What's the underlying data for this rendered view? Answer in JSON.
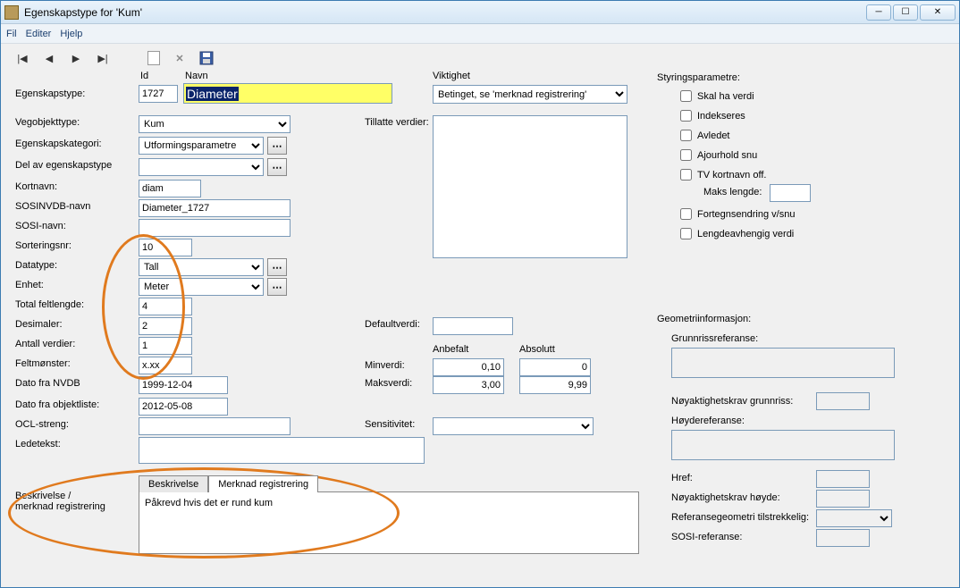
{
  "window": {
    "title": "Egenskapstype for 'Kum'"
  },
  "menu": {
    "fil": "Fil",
    "editer": "Editer",
    "hjelp": "Hjelp"
  },
  "labels": {
    "id": "Id",
    "navn": "Navn",
    "viktighet": "Viktighet",
    "egenskapstype": "Egenskapstype:",
    "vegobjekttype": "Vegobjekttype:",
    "egenskapskategori": "Egenskapskategori:",
    "del_av": "Del av egenskapstype",
    "kortnavn": "Kortnavn:",
    "sosinvdb": "SOSINVDB-navn",
    "sosi_navn": "SOSI-navn:",
    "sorteringsnr": "Sorteringsnr:",
    "datatype": "Datatype:",
    "enhet": "Enhet:",
    "total_feltlengde": "Total feltlengde:",
    "desimaler": "Desimaler:",
    "antall_verdier": "Antall verdier:",
    "feltmonster": "Feltmønster:",
    "dato_nvdb": "Dato fra NVDB",
    "dato_objliste": "Dato fra objektliste:",
    "ocl": "OCL-streng:",
    "ledetekst": "Ledetekst:",
    "beskrivelse": "Beskrivelse /\nmerknad registrering",
    "tillatte": "Tillatte verdier:",
    "defaultverdi": "Defaultverdi:",
    "anbefalt": "Anbefalt",
    "absolutt": "Absolutt",
    "minverdi": "Minverdi:",
    "maksverdi": "Maksverdi:",
    "sensitivitet": "Sensitivitet:",
    "styrings": "Styringsparametre:",
    "skal_ha_verdi": "Skal ha verdi",
    "indekseres": "Indekseres",
    "avledet": "Avledet",
    "ajourhold": "Ajourhold snu",
    "tv_kortnavn": "TV kortnavn off.",
    "maks_lengde": "Maks lengde:",
    "fortegn": "Fortegnsendring v/snu",
    "lengde_avh": "Lengdeavhengig verdi",
    "geo": "Geometriinformasjon:",
    "grunnriss": "Grunnrissreferanse:",
    "noyak_grunn": "Nøyaktighetskrav grunnriss:",
    "hoyderef": "Høydereferanse:",
    "href": "Href:",
    "noyak_hoyde": "Nøyaktighetskrav høyde:",
    "refgeom": "Referansegeometri tilstrekkelig:",
    "sosi_ref": "SOSI-referanse:"
  },
  "values": {
    "id": "1727",
    "navn": "Diameter",
    "viktighet": "Betinget, se 'merknad registrering'",
    "vegobjekttype": "Kum",
    "egenskapskategori": "Utformingsparametre",
    "del_av": "",
    "kortnavn": "diam",
    "sosinvdb": "Diameter_1727",
    "sosi_navn": "",
    "sorteringsnr": "10",
    "datatype": "Tall",
    "enhet": "Meter",
    "total_feltlengde": "4",
    "desimaler": "2",
    "antall_verdier": "1",
    "feltmonster": "x.xx",
    "dato_nvdb": "1999-12-04",
    "dato_objliste": "2012-05-08",
    "ocl": "",
    "ledetekst": "",
    "defaultverdi": "",
    "min_anbefalt": "0,10",
    "min_absolutt": "0",
    "maks_anbefalt": "3,00",
    "maks_absolutt": "9,99",
    "sensitivitet": "",
    "maks_lengde": "",
    "merknad_text": "Påkrevd hvis det er rund kum"
  },
  "tabs": {
    "beskrivelse": "Beskrivelse",
    "merknad": "Merknad registrering"
  }
}
